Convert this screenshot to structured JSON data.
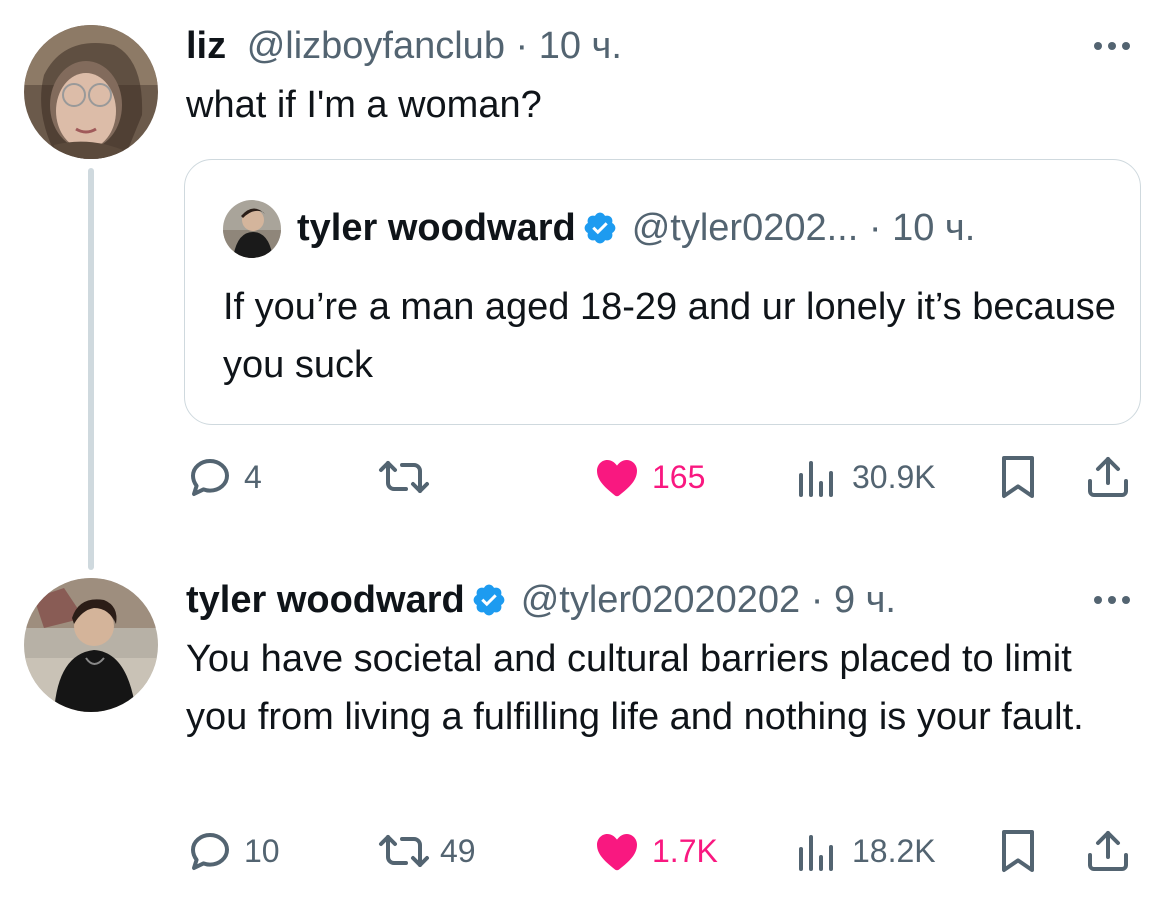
{
  "tweets": [
    {
      "author_name": "liz",
      "handle": "@lizboyfanclub",
      "separator": "·",
      "time": "10 ч.",
      "text": "what if I'm a woman?",
      "quote": {
        "author_name": "tyler woodward",
        "handle": "@tyler0202...",
        "separator": "·",
        "time": "10 ч.",
        "text": "If you’re a man aged 18-29 and ur lonely it’s because you suck"
      },
      "actions": {
        "replies": "4",
        "reposts": "",
        "likes": "165",
        "views": "30.9K"
      }
    },
    {
      "author_name": "tyler woodward",
      "handle": "@tyler02020202",
      "separator": "·",
      "time": "9 ч.",
      "text": "You have societal and cultural barriers placed to limit you from living a fulfilling life and nothing is your fault.",
      "actions": {
        "replies": "10",
        "reposts": "49",
        "likes": "1.7K",
        "views": "18.2K"
      }
    }
  ],
  "colors": {
    "verified": "#1d9bf0",
    "like": "#f91880",
    "secondary": "#536471",
    "border": "#cfd9de"
  },
  "icons": [
    "reply-icon",
    "repost-icon",
    "like-icon",
    "views-icon",
    "bookmark-icon",
    "share-icon",
    "more-icon",
    "verified-badge-icon"
  ]
}
